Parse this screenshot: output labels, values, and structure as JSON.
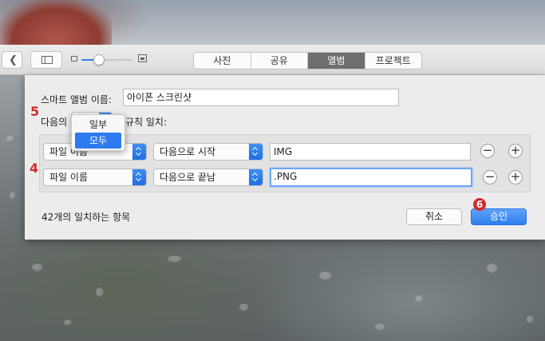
{
  "toolbar": {
    "back_icon": "chevron-left-icon",
    "sidebar_icon": "sidebar-icon",
    "zoom_level": 0.3,
    "tabs": [
      {
        "label": "사진",
        "active": false
      },
      {
        "label": "공유",
        "active": false
      },
      {
        "label": "앨범",
        "active": true
      },
      {
        "label": "프로젝트",
        "active": false
      }
    ]
  },
  "dialog": {
    "name_label": "스마트 앨범 이름:",
    "name_value": "아이폰 스크린샷",
    "match_prefix": "다음의",
    "match_suffix": "규칙 일치:",
    "match_options": [
      "일부",
      "모두"
    ],
    "match_selected": "모두",
    "rules": [
      {
        "field": "파일 이름",
        "operator": "다음으로 시작",
        "value": "IMG"
      },
      {
        "field": "파일 이름",
        "operator": "다음으로 끝남",
        "value": ".PNG"
      }
    ],
    "count_text": "42개의 일치하는 항목",
    "cancel_label": "취소",
    "ok_label": "승인"
  },
  "annotations": {
    "marker_4": "4",
    "marker_5": "5",
    "marker_6": "6"
  },
  "colors": {
    "accent": "#2e7bf0",
    "annotation": "#d12b2b"
  }
}
